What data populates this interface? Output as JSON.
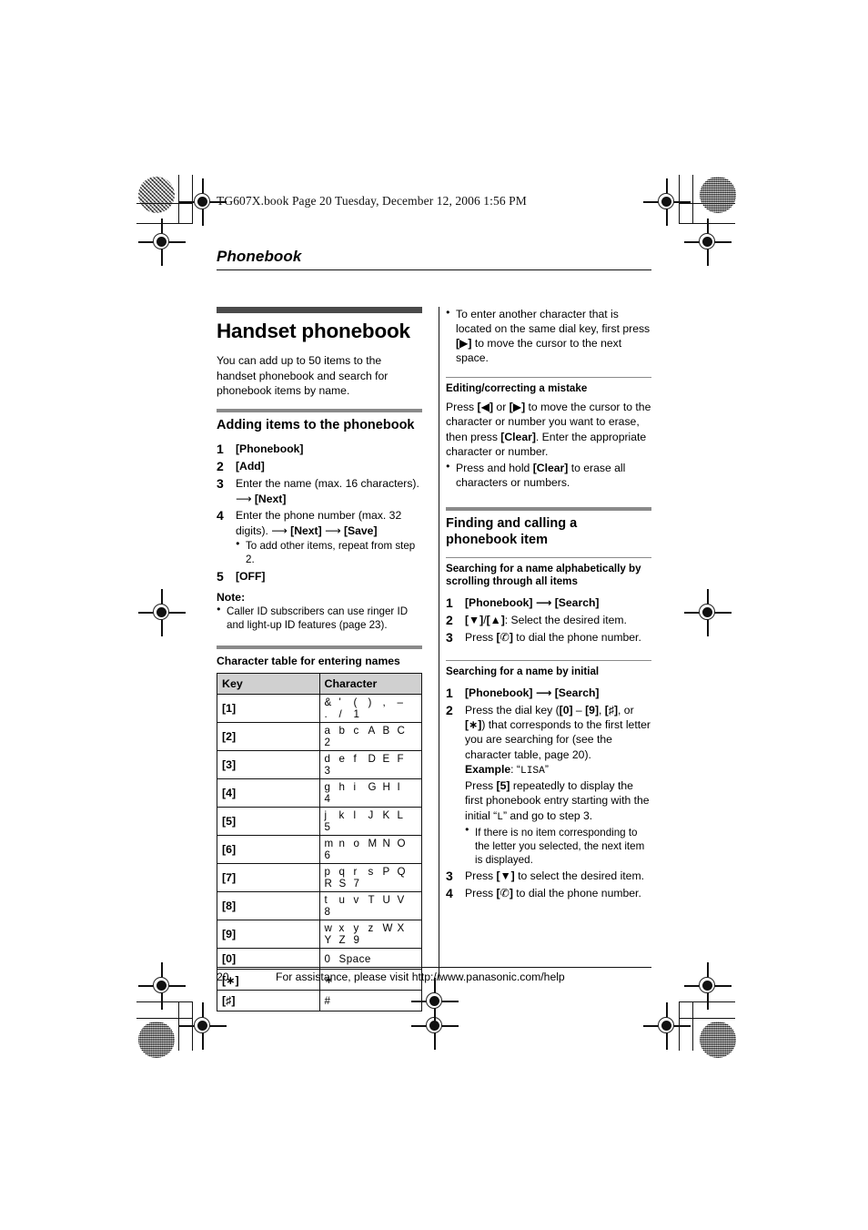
{
  "header_line": "TG607X.book  Page 20  Tuesday, December 12, 2006  1:56 PM",
  "running_head": "Phonebook",
  "colors": {
    "chapter_bar": "#4a4a4a",
    "section_bar": "#8a8a8a",
    "table_header": "#d0d0d0"
  },
  "left_column": {
    "chapter_title": "Handset phonebook",
    "intro": "You can add up to 50 items to the handset phonebook and search for phonebook items by name.",
    "section_title": "Adding items to the phonebook",
    "steps": [
      {
        "num": "1",
        "text": "[Phonebook]"
      },
      {
        "num": "2",
        "text": "[Add]"
      },
      {
        "num": "3",
        "text": "Enter the name (max. 16 characters).  ⟶ [Next]"
      },
      {
        "num": "4",
        "text": "Enter the phone number (max. 32 digits).  ⟶ [Next] ⟶ [Save]",
        "bullets": [
          "To add other items, repeat from step 2."
        ]
      },
      {
        "num": "5",
        "text": "[OFF]"
      }
    ],
    "note_label": "Note:",
    "note_bullets": [
      "Caller ID subscribers can use ringer ID and light-up ID features (page 23)."
    ],
    "table_title": "Character table for entering names",
    "table": {
      "headers": [
        "Key",
        "Character"
      ],
      "rows": [
        {
          "key": "[1]",
          "chars": [
            "&",
            "'",
            "(",
            ")",
            ",",
            "–",
            ".",
            "/",
            "1"
          ]
        },
        {
          "key": "[2]",
          "chars": [
            "a",
            "b",
            "c",
            "A",
            "B",
            "C",
            "2"
          ]
        },
        {
          "key": "[3]",
          "chars": [
            "d",
            "e",
            "f",
            "D",
            "E",
            "F",
            "3"
          ]
        },
        {
          "key": "[4]",
          "chars": [
            "g",
            "h",
            "i",
            "G",
            "H",
            "I",
            "4"
          ]
        },
        {
          "key": "[5]",
          "chars": [
            "j",
            "k",
            "l",
            "J",
            "K",
            "L",
            "5"
          ]
        },
        {
          "key": "[6]",
          "chars": [
            "m",
            "n",
            "o",
            "M",
            "N",
            "O",
            "6"
          ]
        },
        {
          "key": "[7]",
          "chars": [
            "p",
            "q",
            "r",
            "s",
            "P",
            "Q",
            "R",
            "S",
            "7"
          ]
        },
        {
          "key": "[8]",
          "chars": [
            "t",
            "u",
            "v",
            "T",
            "U",
            "V",
            "8"
          ]
        },
        {
          "key": "[9]",
          "chars": [
            "w",
            "x",
            "y",
            "z",
            "W",
            "X",
            "Y",
            "Z",
            "9"
          ]
        },
        {
          "key": "[0]",
          "chars": [
            "0",
            "Space"
          ]
        },
        {
          "key": "[∗]",
          "chars": [
            "∗"
          ]
        },
        {
          "key": "[♯]",
          "chars": [
            "#"
          ]
        }
      ]
    }
  },
  "right_column": {
    "top_bullets": [
      "To enter another character that is located on the same dial key, first press [▶] to move the cursor to the next space."
    ],
    "editing_title": "Editing/correcting a mistake",
    "editing_body": "Press [◀] or [▶] to move the cursor to the character or number you want to erase, then press [Clear]. Enter the appropriate character or number.",
    "editing_bullets": [
      "Press and hold [Clear] to erase all characters or numbers."
    ],
    "section_title": "Finding and calling a phonebook item",
    "sub1_title": "Searching for a name alphabetically by scrolling through all items",
    "sub1_steps": [
      {
        "num": "1",
        "text": "[Phonebook] ⟶ [Search]"
      },
      {
        "num": "2",
        "text": "[▼]/[▲]: Select the desired item."
      },
      {
        "num": "3",
        "text": "Press [✆] to dial the phone number."
      }
    ],
    "sub2_title": "Searching for a name by initial",
    "sub2_steps": [
      {
        "num": "1",
        "text": "[Phonebook] ⟶ [Search]"
      },
      {
        "num": "2",
        "text": "Press the dial key ([0] – [9], [♯], or [∗]) that corresponds to the first letter you are searching for (see the character table, page 20).",
        "example_label": "Example",
        "example_value": "LISA",
        "example_body_pre": "Press [5] repeatedly to display the first phonebook entry starting with the initial “",
        "example_mono": "L",
        "example_body_post": "” and go to step 3.",
        "bullets": [
          "If there is no item corresponding to the letter you selected, the next item is displayed."
        ]
      },
      {
        "num": "3",
        "text": "Press [▼] to select the desired item."
      },
      {
        "num": "4",
        "text": "Press [✆] to dial the phone number."
      }
    ]
  },
  "footer": {
    "page_number": "20",
    "text": "For assistance, please visit http://www.panasonic.com/help"
  }
}
